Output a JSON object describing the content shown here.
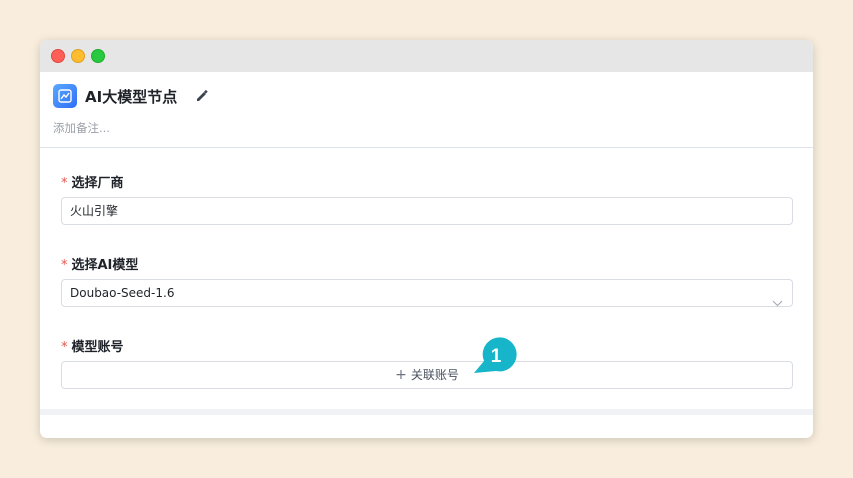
{
  "node": {
    "title": "AI大模型节点",
    "remark_placeholder": "添加备注..."
  },
  "form": {
    "vendor": {
      "label": "选择厂商",
      "value": "火山引擎"
    },
    "model": {
      "label": "选择AI模型",
      "value": "Doubao-Seed-1.6"
    },
    "account": {
      "label": "模型账号",
      "button_label": "关联账号"
    },
    "required_mark": "*"
  },
  "callout": {
    "number": "1",
    "color": "#17b5c9"
  },
  "colors": {
    "background": "#f9eedd",
    "accent": "#2f6df6",
    "required": "#e8534c"
  }
}
